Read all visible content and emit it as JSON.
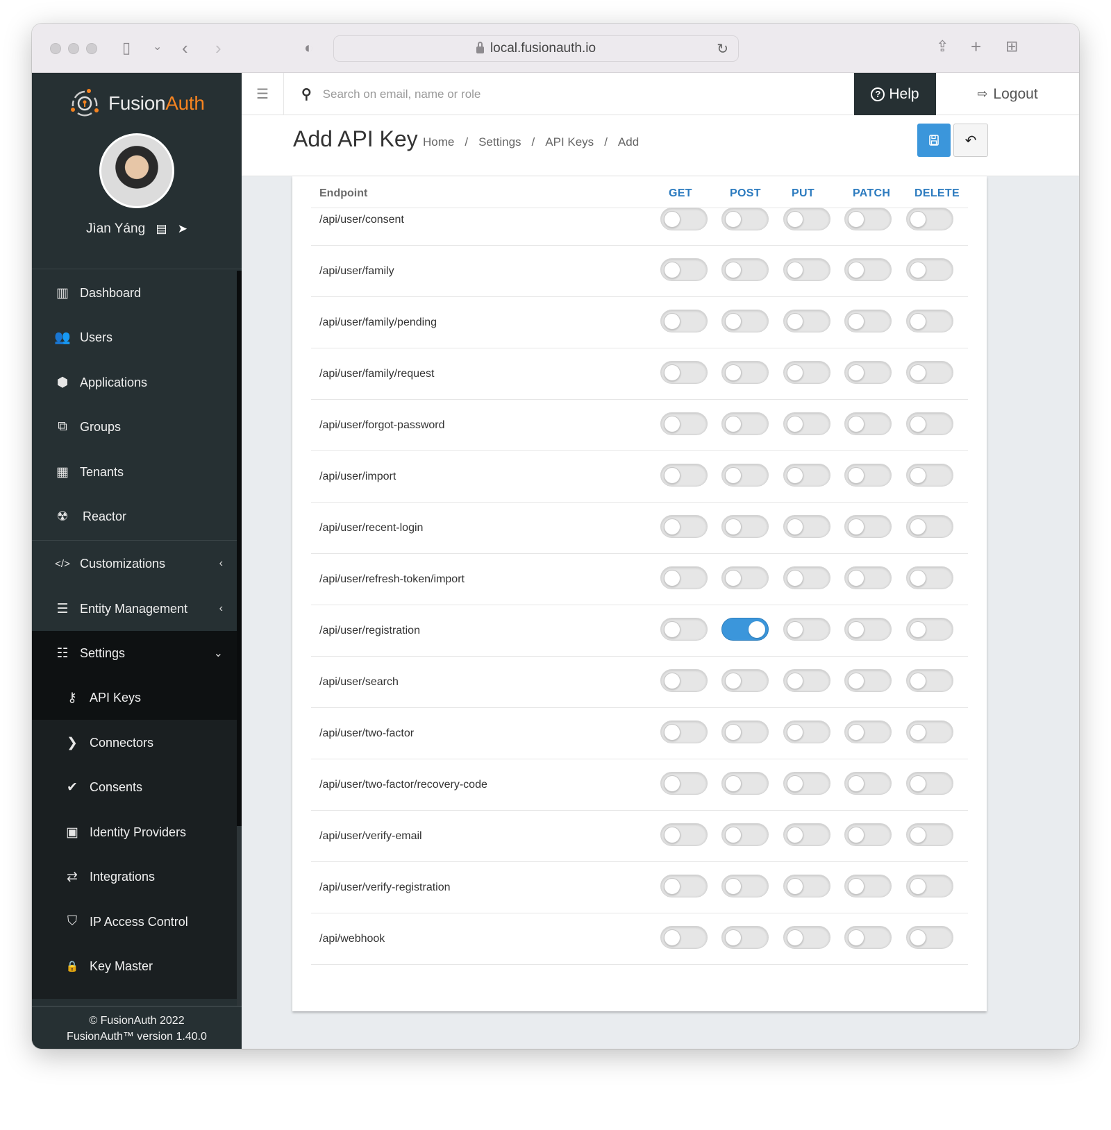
{
  "browser": {
    "url": "local.fusionauth.io"
  },
  "sidebar": {
    "brand_fusion": "Fusion",
    "brand_auth": "Auth",
    "user_name": "Jìan Yáng",
    "nav": [
      {
        "label": "Dashboard",
        "icon": "▥"
      },
      {
        "label": "Users",
        "icon": "👥"
      },
      {
        "label": "Applications",
        "icon": "⬢"
      },
      {
        "label": "Groups",
        "icon": "⧉"
      },
      {
        "label": "Tenants",
        "icon": "▦"
      },
      {
        "label": "Reactor",
        "icon": "☢"
      },
      {
        "label": "Customizations",
        "icon": "</>"
      },
      {
        "label": "Entity Management",
        "icon": "☰"
      },
      {
        "label": "Settings",
        "icon": "☷"
      }
    ],
    "settings_sub": [
      {
        "label": "API Keys",
        "icon": "⚷"
      },
      {
        "label": "Connectors",
        "icon": "❯"
      },
      {
        "label": "Consents",
        "icon": "✔"
      },
      {
        "label": "Identity Providers",
        "icon": "▣"
      },
      {
        "label": "Integrations",
        "icon": "⇄"
      },
      {
        "label": "IP Access Control",
        "icon": "⛉"
      },
      {
        "label": "Key Master",
        "icon": "🔒"
      }
    ],
    "footer_copyright": "© FusionAuth 2022",
    "footer_version": "FusionAuth™ version 1.40.0"
  },
  "header": {
    "search_placeholder": "Search on email, name or role",
    "help_label": "Help",
    "logout_label": "Logout"
  },
  "page": {
    "title": "Add API Key",
    "breadcrumb": [
      "Home",
      "Settings",
      "API Keys",
      "Add"
    ]
  },
  "table": {
    "endpoint_header": "Endpoint",
    "methods": [
      "GET",
      "POST",
      "PUT",
      "PATCH",
      "DELETE"
    ],
    "rows": [
      {
        "endpoint": "/api/user/consent",
        "enabled": [
          false,
          false,
          false,
          false,
          false
        ]
      },
      {
        "endpoint": "/api/user/family",
        "enabled": [
          false,
          false,
          false,
          false,
          false
        ]
      },
      {
        "endpoint": "/api/user/family/pending",
        "enabled": [
          false,
          false,
          false,
          false,
          false
        ]
      },
      {
        "endpoint": "/api/user/family/request",
        "enabled": [
          false,
          false,
          false,
          false,
          false
        ]
      },
      {
        "endpoint": "/api/user/forgot-password",
        "enabled": [
          false,
          false,
          false,
          false,
          false
        ]
      },
      {
        "endpoint": "/api/user/import",
        "enabled": [
          false,
          false,
          false,
          false,
          false
        ]
      },
      {
        "endpoint": "/api/user/recent-login",
        "enabled": [
          false,
          false,
          false,
          false,
          false
        ]
      },
      {
        "endpoint": "/api/user/refresh-token/import",
        "enabled": [
          false,
          false,
          false,
          false,
          false
        ]
      },
      {
        "endpoint": "/api/user/registration",
        "enabled": [
          false,
          true,
          false,
          false,
          false
        ]
      },
      {
        "endpoint": "/api/user/search",
        "enabled": [
          false,
          false,
          false,
          false,
          false
        ]
      },
      {
        "endpoint": "/api/user/two-factor",
        "enabled": [
          false,
          false,
          false,
          false,
          false
        ]
      },
      {
        "endpoint": "/api/user/two-factor/recovery-code",
        "enabled": [
          false,
          false,
          false,
          false,
          false
        ]
      },
      {
        "endpoint": "/api/user/verify-email",
        "enabled": [
          false,
          false,
          false,
          false,
          false
        ]
      },
      {
        "endpoint": "/api/user/verify-registration",
        "enabled": [
          false,
          false,
          false,
          false,
          false
        ]
      },
      {
        "endpoint": "/api/webhook",
        "enabled": [
          false,
          false,
          false,
          false,
          false
        ]
      }
    ]
  },
  "colors": {
    "accent": "#3b96db",
    "brand_orange": "#f58320",
    "sidebar_bg": "#263033",
    "method_header": "#2c7bbf"
  }
}
